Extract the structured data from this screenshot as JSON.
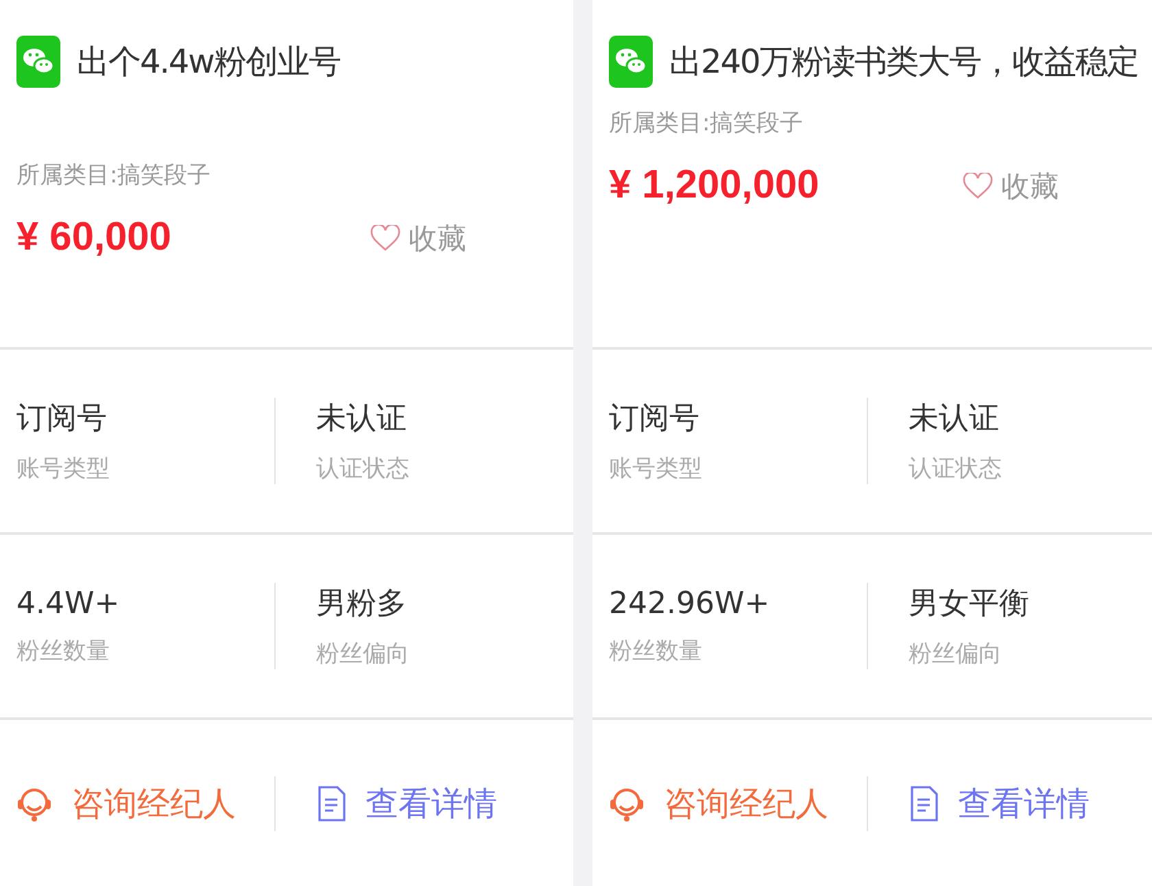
{
  "listings": [
    {
      "title": "出个4.4w粉创业号",
      "category": "所属类目:搞笑段子",
      "price": "¥ 60,000",
      "favorite": {
        "label": "收藏",
        "selected": false
      },
      "stats": [
        [
          {
            "value": "订阅号",
            "label": "账号类型"
          },
          {
            "value": "未认证",
            "label": "认证状态"
          }
        ],
        [
          {
            "value": "4.4W+",
            "label": "粉丝数量"
          },
          {
            "value": "男粉多",
            "label": "粉丝偏向"
          }
        ]
      ],
      "actions": [
        {
          "kind": "consult",
          "label": "咨询经纪人"
        },
        {
          "kind": "details",
          "label": "查看详情"
        }
      ]
    },
    {
      "title": "出240万粉读书类大号，收益稳定",
      "category": "所属类目:搞笑段子",
      "price": "¥ 1,200,000",
      "favorite": {
        "label": "收藏",
        "selected": false
      },
      "stats": [
        [
          {
            "value": "订阅号",
            "label": "账号类型"
          },
          {
            "value": "未认证",
            "label": "认证状态"
          }
        ],
        [
          {
            "value": "242.96W+",
            "label": "粉丝数量"
          },
          {
            "value": "男女平衡",
            "label": "粉丝偏向"
          }
        ]
      ],
      "actions": [
        {
          "kind": "consult",
          "label": "咨询经纪人"
        },
        {
          "kind": "details",
          "label": "查看详情"
        }
      ]
    }
  ]
}
